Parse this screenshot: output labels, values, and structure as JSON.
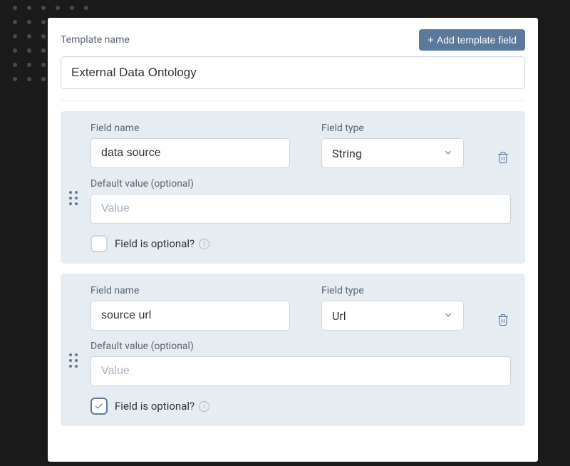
{
  "header": {
    "label": "Template name",
    "add_button_label": "Add template field"
  },
  "template_name": "External Data Ontology",
  "fields": [
    {
      "name_label": "Field name",
      "name_value": "data source",
      "type_label": "Field type",
      "type_value": "String",
      "default_label": "Default value (optional)",
      "default_placeholder": "Value",
      "default_value": "",
      "optional_label": "Field is optional?",
      "optional_checked": false
    },
    {
      "name_label": "Field name",
      "name_value": "source url",
      "type_label": "Field type",
      "type_value": "Url",
      "default_label": "Default value (optional)",
      "default_placeholder": "Value",
      "default_value": "",
      "optional_label": "Field is optional?",
      "optional_checked": true
    }
  ]
}
